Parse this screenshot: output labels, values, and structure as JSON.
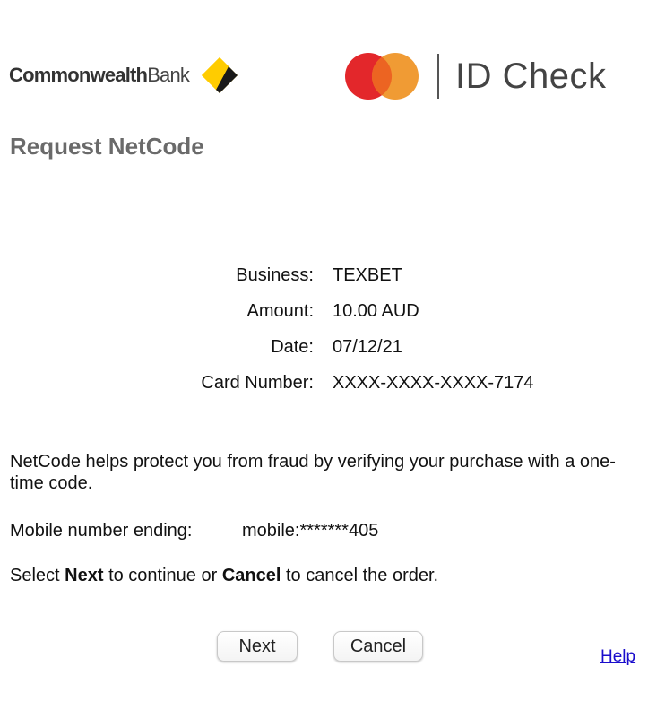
{
  "header": {
    "bank_logo": {
      "text_bold": "Commonwealth",
      "text_light": "Bank",
      "icon": "cba-diamond-icon"
    },
    "mastercard_logo": {
      "icon": "mastercard-circles-icon",
      "text": "ID Check",
      "colors": {
        "red": "#e3272b",
        "orange": "#f09b34",
        "overlap": "#ec6422"
      }
    }
  },
  "page": {
    "title": "Request NetCode"
  },
  "details": [
    {
      "label": "Business:",
      "value": "TEXBET"
    },
    {
      "label": "Amount:",
      "value": "10.00 AUD"
    },
    {
      "label": "Date:",
      "value": "07/12/21"
    },
    {
      "label": "Card Number:",
      "value": "XXXX-XXXX-XXXX-7174"
    }
  ],
  "info": {
    "text": "NetCode helps protect you from fraud by verifying your purchase with a one-time code."
  },
  "mobile": {
    "label": "Mobile number ending:",
    "value": "mobile:*******405"
  },
  "instruction": {
    "part1": "Select ",
    "next": "Next",
    "part2": " to continue or ",
    "cancel": "Cancel",
    "part3": " to cancel the order."
  },
  "buttons": {
    "next_label": "Next",
    "cancel_label": "Cancel"
  },
  "help": {
    "label": "Help"
  },
  "colors": {
    "title_gray": "#6a6a6a",
    "link_blue": "#1a0dcc",
    "cba_yellow": "#ffcc00"
  }
}
